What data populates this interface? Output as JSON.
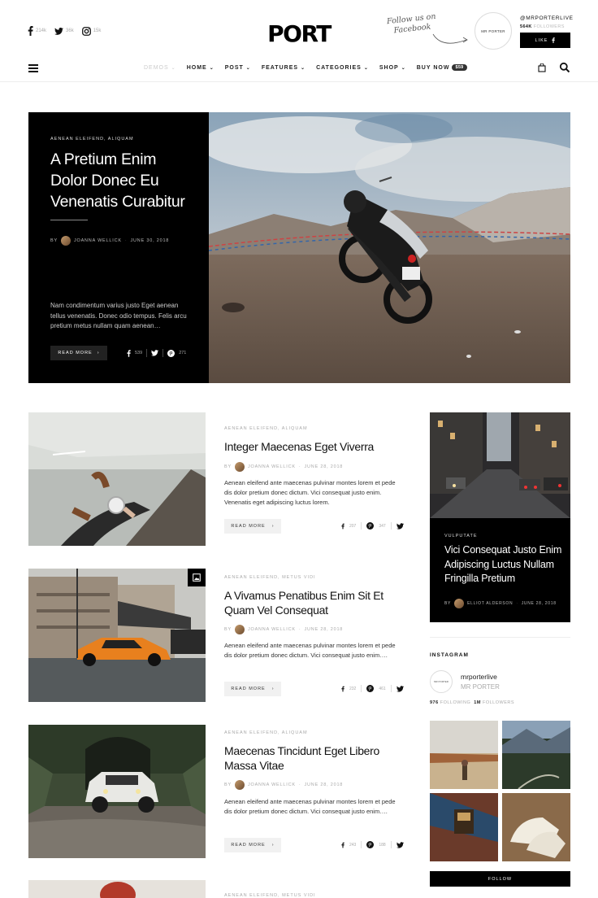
{
  "header": {
    "social": [
      {
        "icon": "facebook-icon",
        "count": "214k"
      },
      {
        "icon": "twitter-icon",
        "count": "36k"
      },
      {
        "icon": "instagram-icon",
        "count": "15k"
      }
    ],
    "logo": "PORT",
    "follow_text": "Follow us on Facebook",
    "fb_circle_label": "MR PORTER",
    "fb_handle": "@MRPORTERLIVE",
    "fb_count": "564K",
    "fb_count_label": "FOLLOWERS",
    "like_label": "LIKE"
  },
  "nav": {
    "items": [
      {
        "label": "DEMOS",
        "muted": true,
        "caret": true
      },
      {
        "label": "HOME",
        "caret": true
      },
      {
        "label": "POST",
        "caret": true
      },
      {
        "label": "FEATURES",
        "caret": true
      },
      {
        "label": "CATEGORIES",
        "caret": true
      },
      {
        "label": "SHOP",
        "caret": true
      },
      {
        "label": "BUY NOW",
        "badge": "$59"
      }
    ]
  },
  "hero": {
    "category": "AENEAN ELEIFEND,  ALIQUAM",
    "title": "A Pretium Enim Dolor Donec Eu Venenatis Curabitur",
    "by": "BY",
    "author": "JOANNA WELLICK",
    "date": "JUNE 30, 2018",
    "excerpt": "Nam condimentum varius justo Eget aenean tellus venenatis. Donec odio tempus. Felis arcu pretium metus nullam quam aenean…",
    "read_more": "READ MORE",
    "fb_count": "539",
    "pin_count": "271"
  },
  "posts": [
    {
      "category": "AENEAN ELEIFEND,  ALIQUAM",
      "title": "Integer Maecenas Eget Viverra",
      "by": "BY",
      "author": "JOANNA WELLICK",
      "date": "JUNE 28, 2018",
      "excerpt": "Aenean eleifend ante maecenas pulvinar montes lorem et pede dis dolor pretium donec dictum. Vici consequat justo enim. Venenatis eget adipiscing luctus lorem.",
      "read_more": "READ MORE",
      "fb_count": "207",
      "pin_count": "347"
    },
    {
      "category": "AENEAN ELEIFEND,  METUS VIDI",
      "title": "A Vivamus Penatibus Enim Sit Et Quam Vel Consequat",
      "by": "BY",
      "author": "JOANNA WELLICK",
      "date": "JUNE 28, 2018",
      "excerpt": "Aenean eleifend ante maecenas pulvinar montes lorem et pede dis dolor pretium donec dictum. Vici consequat justo enim….",
      "read_more": "READ MORE",
      "fb_count": "232",
      "pin_count": "461"
    },
    {
      "category": "AENEAN ELEIFEND,  ALIQUAM",
      "title": "Maecenas Tincidunt Eget Libero Massa Vitae",
      "by": "BY",
      "author": "JOANNA WELLICK",
      "date": "JUNE 28, 2018",
      "excerpt": "Aenean eleifend ante maecenas pulvinar montes lorem et pede dis dolor pretium donec dictum. Vici consequat justo enim….",
      "read_more": "READ MORE",
      "fb_count": "243",
      "pin_count": "188"
    },
    {
      "category": "AENEAN ELEIFEND,  METUS VIDI"
    }
  ],
  "sidebar": {
    "feature": {
      "category": "VULPUTATE",
      "title": "Vici Consequat Justo Enim Adipiscing Luctus Nullam Fringilla Pretium",
      "by": "BY",
      "author": "ELLIOT ALDERSON",
      "date": "JUNE 28, 2018"
    },
    "instagram": {
      "heading": "INSTAGRAM",
      "avatar_label": "MR PORTER",
      "username": "mrporterlive",
      "name": "MR PORTER",
      "following": "976",
      "following_label": "FOLLOWING",
      "followers": "1M",
      "followers_label": "FOLLOWERS",
      "follow_label": "FOLLOW"
    }
  }
}
